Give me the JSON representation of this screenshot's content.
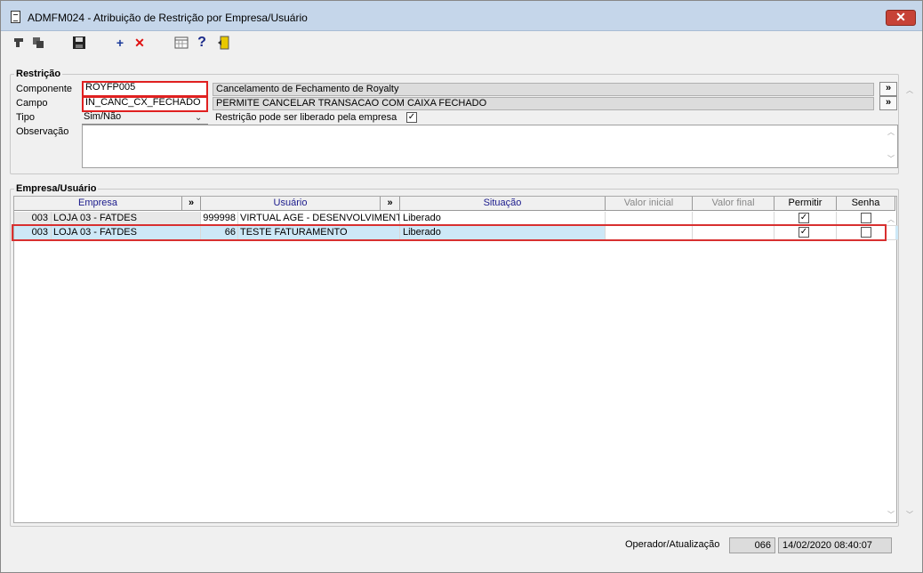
{
  "window": {
    "title": "ADMFM024 - Atribuição de Restrição por Empresa/Usuário",
    "close_glyph": "✕"
  },
  "toolbar": {
    "icons": [
      "pointer-icon",
      "copy-icon",
      "save-icon",
      "add-icon",
      "delete-icon",
      "calendar-icon",
      "help-icon",
      "exit-icon"
    ]
  },
  "restricao": {
    "title": "Restrição",
    "componente_label": "Componente",
    "componente_value": "ROYFP005",
    "componente_desc": "Cancelamento de Fechamento de Royalty",
    "campo_label": "Campo",
    "campo_value": "IN_CANC_CX_FECHADO",
    "campo_desc": "PERMITE CANCELAR TRANSACAO COM CAIXA FECHADO",
    "tipo_label": "Tipo",
    "tipo_value": "Sim/Não",
    "liberado_label": "Restrição pode ser liberado pela empresa",
    "liberado_checked": true,
    "observacao_label": "Observação",
    "observacao_value": "",
    "expand_glyph": "»"
  },
  "empresa_usuario": {
    "title": "Empresa/Usuário",
    "columns": {
      "empresa": "Empresa",
      "usuario": "Usuário",
      "situacao": "Situação",
      "valor_inicial": "Valor inicial",
      "valor_final": "Valor final",
      "permitir": "Permitir",
      "senha": "Senha",
      "expand": "»"
    },
    "rows": [
      {
        "emp_cod": "003",
        "emp_nome": "LOJA 03 - FATDES",
        "usr_cod": "999998",
        "usr_nome": "VIRTUAL AGE - DESENVOLVIMENTO",
        "situacao": "Liberado",
        "valor_inicial": "",
        "valor_final": "",
        "permitir": true,
        "senha": false
      },
      {
        "emp_cod": "003",
        "emp_nome": "LOJA 03 - FATDES",
        "usr_cod": "66",
        "usr_nome": "TESTE FATURAMENTO",
        "situacao": "Liberado",
        "valor_inicial": "",
        "valor_final": "",
        "permitir": true,
        "senha": false
      }
    ]
  },
  "status": {
    "label": "Operador/Atualização",
    "operador": "066",
    "atualizacao": "14/02/2020 08:40:07"
  }
}
